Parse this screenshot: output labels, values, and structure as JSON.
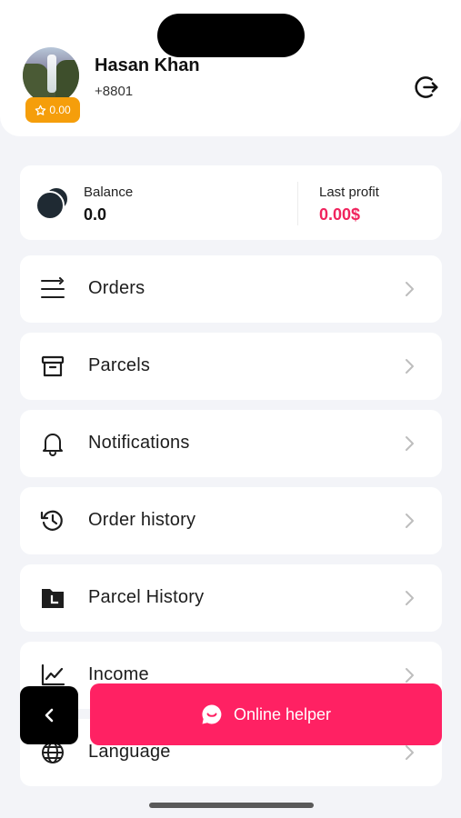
{
  "profile": {
    "name": "Hasan Khan",
    "phone": "+8801",
    "rating": "0.00",
    "rating_icon": "star-icon"
  },
  "balance": {
    "label": "Balance",
    "value": "0.0",
    "profit_label": "Last profit",
    "profit_value": "0.00$"
  },
  "menu": [
    {
      "label": "Orders",
      "icon": "list-icon"
    },
    {
      "label": "Parcels",
      "icon": "archive-box-icon"
    },
    {
      "label": "Notifications",
      "icon": "bell-icon"
    },
    {
      "label": "Order history",
      "icon": "history-icon"
    },
    {
      "label": "Parcel History",
      "icon": "folder-clock-icon"
    },
    {
      "label": "Income",
      "icon": "chart-line-icon"
    },
    {
      "label": "Language",
      "icon": "globe-icon"
    }
  ],
  "helper": {
    "label": "Online helper",
    "icon": "chat-bubble-icon"
  },
  "colors": {
    "accent": "#ff2163",
    "profit": "#f0245e",
    "badge": "#f59e0b",
    "background": "#f3f4f8"
  }
}
